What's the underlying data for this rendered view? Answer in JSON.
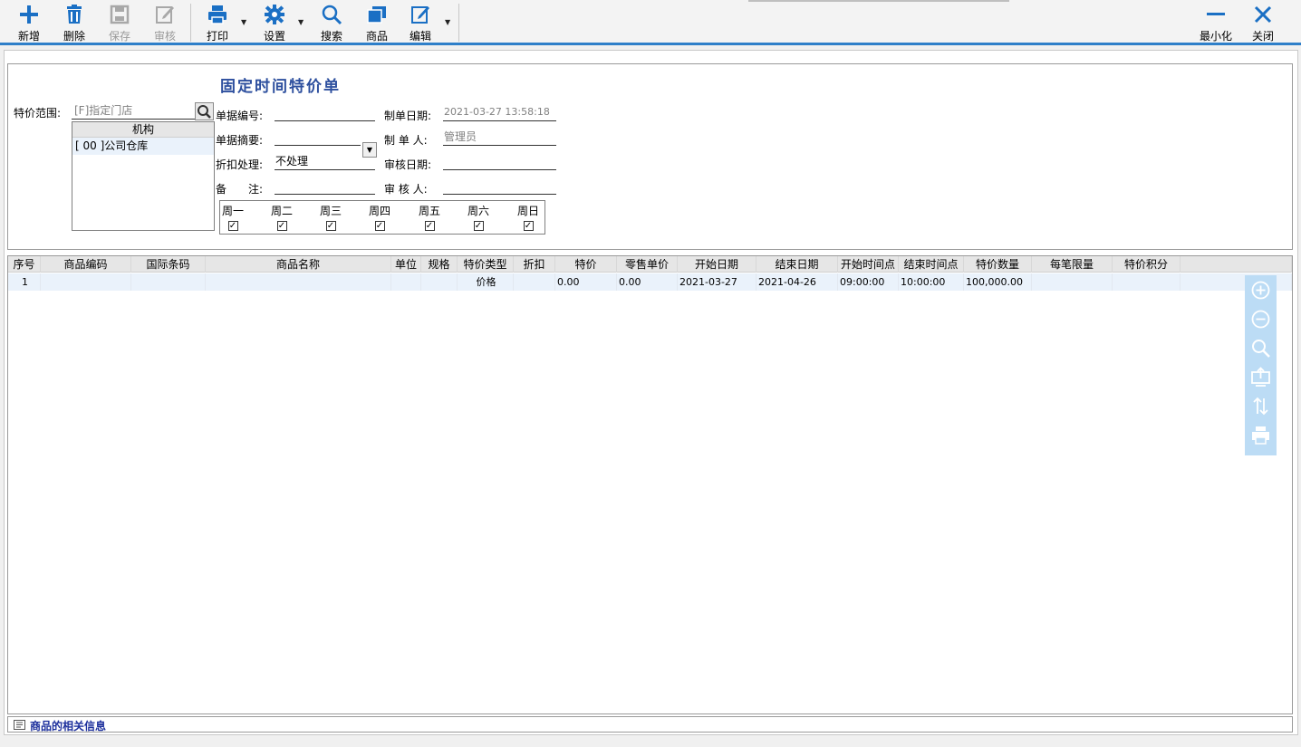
{
  "toolbar": {
    "add": "新增",
    "delete": "删除",
    "save": "保存",
    "audit": "审核",
    "print": "打印",
    "settings": "设置",
    "search": "搜索",
    "goods": "商品",
    "edit": "编辑",
    "minimize": "最小化",
    "close": "关闭",
    "accent_color": "#2e7fc9",
    "icon_color": "#1a6fc4"
  },
  "form": {
    "title": "固定时间特价单",
    "scope_label": "特价范围:",
    "scope_placeholder": "[F]指定门店",
    "org_column": "机构",
    "org_row": "[ 00 ]公司仓库",
    "doc_no_label": "单据编号:",
    "doc_no_value": "",
    "summary_label": "单据摘要:",
    "summary_value": "",
    "discount_label": "折扣处理:",
    "discount_value": "不处理",
    "remark_label": "备　　注:",
    "remark_value": "",
    "create_date_label": "制单日期:",
    "create_date_value": "2021-03-27 13:58:18",
    "creator_label": "制 单 人:",
    "creator_value": "管理员",
    "audit_date_label": "审核日期:",
    "audit_date_value": "",
    "auditor_label": "审 核 人:",
    "auditor_value": "",
    "weekdays": [
      "周一",
      "周二",
      "周三",
      "周四",
      "周五",
      "周六",
      "周日"
    ],
    "weekday_checked": [
      true,
      true,
      true,
      true,
      true,
      true,
      true
    ]
  },
  "grid": {
    "columns": [
      "序号",
      "商品编码",
      "国际条码",
      "商品名称",
      "单位",
      "规格",
      "特价类型",
      "折扣",
      "特价",
      "零售单价",
      "开始日期",
      "结束日期",
      "开始时间点",
      "结束时间点",
      "特价数量",
      "每笔限量",
      "特价积分"
    ],
    "rows": [
      [
        "1",
        "",
        "",
        "",
        "",
        "",
        "价格",
        "",
        "0.00",
        "0.00",
        "2021-03-27",
        "2021-04-26",
        "09:00:00",
        "10:00:00",
        "100,000.00",
        "",
        ""
      ]
    ]
  },
  "side_panel": {
    "icons": [
      "zoom-in-icon",
      "zoom-out-icon",
      "search-icon",
      "export-icon",
      "sort-icon",
      "print-icon"
    ]
  },
  "footer": {
    "text": "商品的相关信息"
  }
}
